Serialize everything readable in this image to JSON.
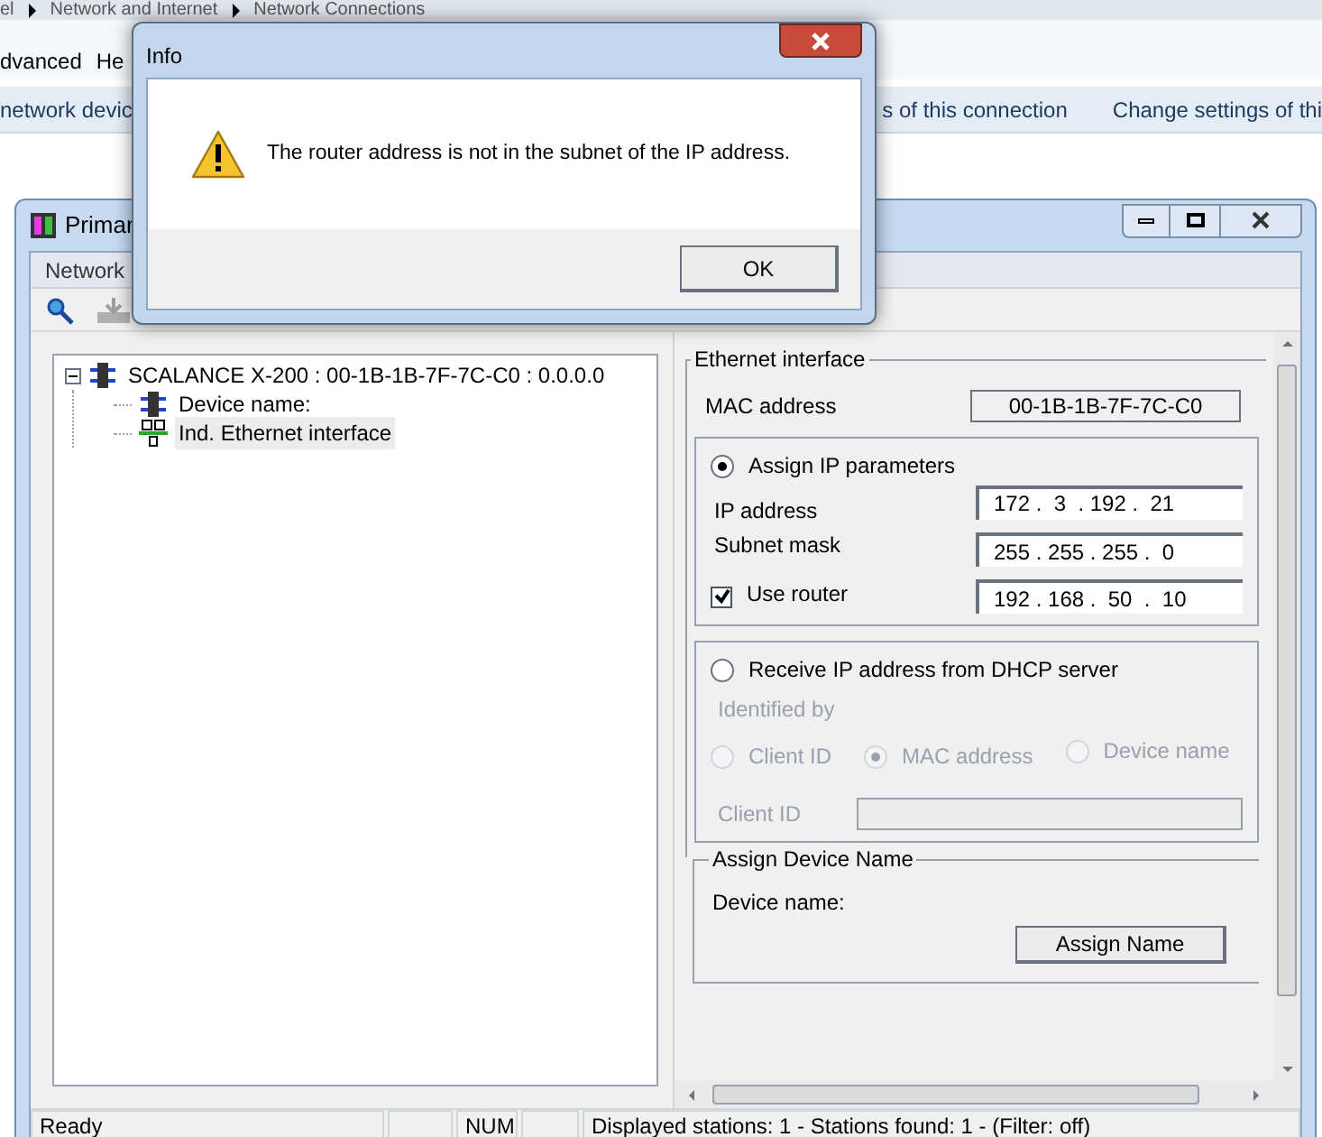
{
  "background_window": {
    "breadcrumb": [
      "el",
      "Network and Internet",
      "Network Connections"
    ],
    "menu": [
      "dvanced",
      "He"
    ],
    "toolbar": [
      "network devic",
      "s of this connection",
      "Change settings of thi"
    ]
  },
  "main_window": {
    "title": "Primar",
    "menu": [
      "Network"
    ],
    "tree": [
      {
        "label": "SCALANCE X-200 : 00-1B-1B-7F-7C-C0 : 0.0.0.0",
        "kind": "device",
        "expanded": true,
        "selected": false,
        "children": [
          {
            "label": "Device name:",
            "kind": "device",
            "selected": false
          },
          {
            "label": "Ind. Ethernet interface",
            "kind": "ethernet",
            "selected": true
          }
        ]
      }
    ],
    "ethernet_interface": {
      "title": "Ethernet interface",
      "mac_label": "MAC address",
      "mac_value": "00-1B-1B-7F-7C-C0",
      "assign_ip": {
        "label": "Assign IP parameters",
        "selected": true,
        "ip_label": "IP address",
        "ip": "172 .  3  . 192 .  21",
        "subnet_label": "Subnet mask",
        "subnet": "255 . 255 . 255 .  0",
        "router": {
          "label": "Use router",
          "checked": true,
          "value": "192 . 168 .  50  .  10"
        }
      },
      "dhcp": {
        "label": "Receive IP address from DHCP server",
        "selected": false,
        "disabled": true,
        "identified_by": "Identified by",
        "options": [
          {
            "label": "Client ID",
            "selected": false
          },
          {
            "label": "MAC address",
            "selected": true
          },
          {
            "label": "Device name",
            "selected": false
          }
        ],
        "client_id_label": "Client ID"
      }
    },
    "assign_device_name": {
      "title": "Assign Device Name",
      "label": "Device name:",
      "button": "Assign Name"
    },
    "status_bar": {
      "message": "Ready",
      "num": "NUM",
      "stations": "Displayed stations: 1 - Stations found: 1 - (Filter: off)"
    }
  },
  "dialog": {
    "title": "Info",
    "message": "The router address is not in the subnet of the IP address.",
    "button": "OK"
  }
}
